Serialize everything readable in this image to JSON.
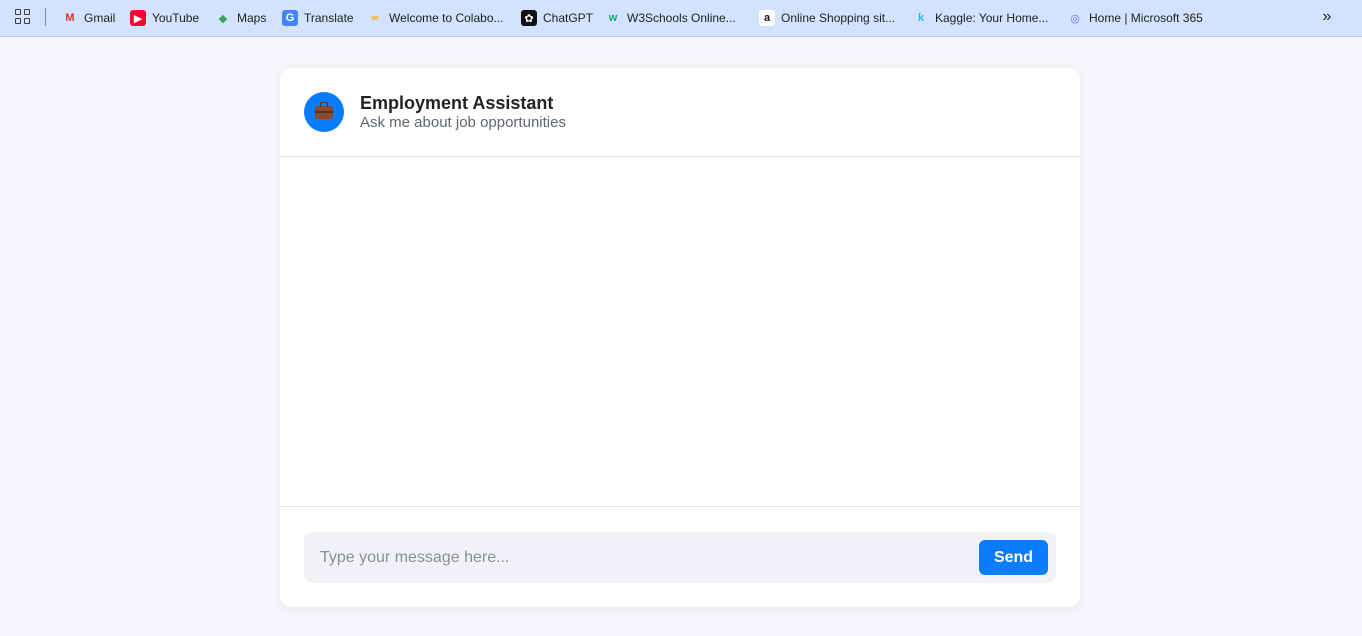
{
  "bookmarks": [
    {
      "label": "Gmail",
      "icon": "gmail-icon",
      "glyph": "M",
      "color": "#d93025",
      "bg": "transparent"
    },
    {
      "label": "YouTube",
      "icon": "youtube-icon",
      "glyph": "▶",
      "color": "#ffffff",
      "bg": "#ff0033"
    },
    {
      "label": "Maps",
      "icon": "maps-icon",
      "glyph": "◆",
      "color": "#34a853",
      "bg": "transparent"
    },
    {
      "label": "Translate",
      "icon": "translate-icon",
      "glyph": "G",
      "color": "#ffffff",
      "bg": "#4285f4"
    },
    {
      "label": "Welcome to Colabo...",
      "icon": "colab-icon",
      "glyph": "∞",
      "color": "#f9ab00",
      "bg": "transparent"
    },
    {
      "label": "ChatGPT",
      "icon": "chatgpt-icon",
      "glyph": "✿",
      "color": "#ffffff",
      "bg": "#111111"
    },
    {
      "label": "W3Schools Online...",
      "icon": "w3schools-icon",
      "glyph": "w",
      "color": "#04aa6d",
      "bg": "transparent"
    },
    {
      "label": "Online Shopping sit...",
      "icon": "amazon-icon",
      "glyph": "a",
      "color": "#111111",
      "bg": "#ffffff"
    },
    {
      "label": "Kaggle: Your Home...",
      "icon": "kaggle-icon",
      "glyph": "k",
      "color": "#20beff",
      "bg": "transparent"
    },
    {
      "label": "Home | Microsoft 365",
      "icon": "microsoft365-icon",
      "glyph": "◎",
      "color": "#7b61ff",
      "bg": "transparent"
    }
  ],
  "more_glyph": "»",
  "chat": {
    "title": "Employment Assistant",
    "subtitle": "Ask me about job opportunities",
    "input_placeholder": "Type your message here...",
    "send_label": "Send"
  },
  "colors": {
    "accent": "#0a7cff",
    "background": "#f5f6fa",
    "bookmarks_bar": "#d3e3fd"
  }
}
